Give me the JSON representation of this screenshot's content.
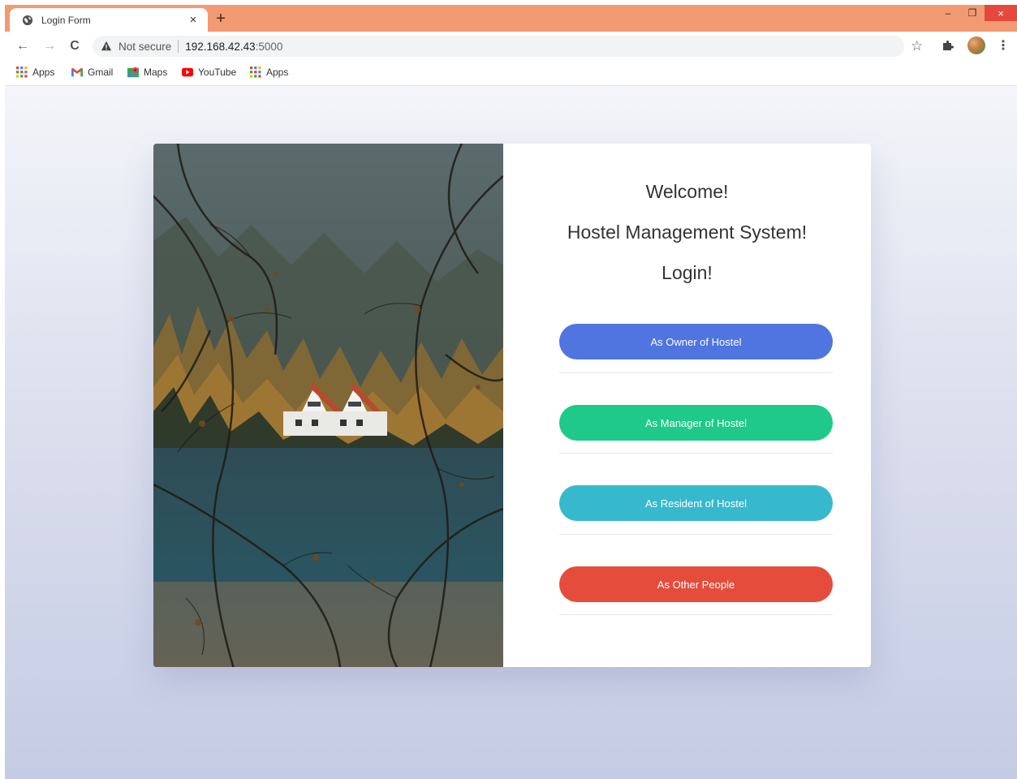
{
  "browser": {
    "tab": {
      "title": "Login Form",
      "close": "×",
      "favicon": "globe-icon"
    },
    "new_tab": "+",
    "window_controls": {
      "minimize": "–",
      "restore": "❐",
      "close": "×"
    },
    "nav": {
      "back": "←",
      "forward": "→",
      "reload": "C"
    },
    "address": {
      "security_label": "Not secure",
      "host": "192.168.42.43",
      "port": ":5000"
    },
    "toolbar_icons": {
      "star": "☆",
      "menu": "⋮"
    },
    "bookmarks": [
      {
        "label": "Apps",
        "icon": "apps-grid-icon"
      },
      {
        "label": "Gmail",
        "icon": "gmail-icon"
      },
      {
        "label": "Maps",
        "icon": "maps-icon"
      },
      {
        "label": "YouTube",
        "icon": "youtube-icon"
      },
      {
        "label": "Apps",
        "icon": "apps-grid-icon"
      }
    ]
  },
  "page": {
    "welcome": "Welcome!",
    "system_title": "Hostel Management System!",
    "login_title": "Login!",
    "buttons": [
      {
        "label": "As Owner of Hostel",
        "color": "#5075e0"
      },
      {
        "label": "As Manager of Hostel",
        "color": "#1ec98a"
      },
      {
        "label": "As Resident of Hostel",
        "color": "#36b9cc"
      },
      {
        "label": "As Other People",
        "color": "#e54c3c"
      }
    ]
  }
}
